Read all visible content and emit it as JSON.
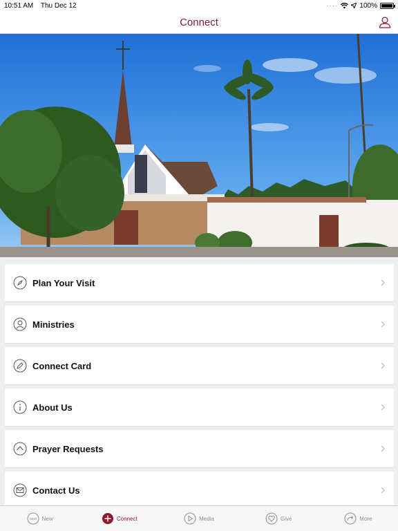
{
  "status_bar": {
    "time": "10:51 AM",
    "date": "Thu Dec 12",
    "battery": "100%"
  },
  "nav": {
    "title": "Connect",
    "profile_icon": "person-icon"
  },
  "colors": {
    "accent": "#8a1c2b",
    "background": "#efeff1"
  },
  "menu": {
    "items": [
      {
        "label": "Plan Your Visit",
        "icon": "compass-icon"
      },
      {
        "label": "Ministries",
        "icon": "person-circle-icon"
      },
      {
        "label": "Connect Card",
        "icon": "pencil-icon"
      },
      {
        "label": "About Us",
        "icon": "info-icon"
      },
      {
        "label": "Prayer Requests",
        "icon": "chevron-up-circle-icon"
      },
      {
        "label": "Contact Us",
        "icon": "envelope-icon"
      }
    ]
  },
  "tabs": [
    {
      "label": "New",
      "icon": "new-badge-icon",
      "active": false,
      "badge": "NEW"
    },
    {
      "label": "Connect",
      "icon": "plus-circle-icon",
      "active": true
    },
    {
      "label": "Media",
      "icon": "play-icon",
      "active": false
    },
    {
      "label": "Give",
      "icon": "heart-icon",
      "active": false
    },
    {
      "label": "More",
      "icon": "forward-arrow-icon",
      "active": false
    }
  ]
}
